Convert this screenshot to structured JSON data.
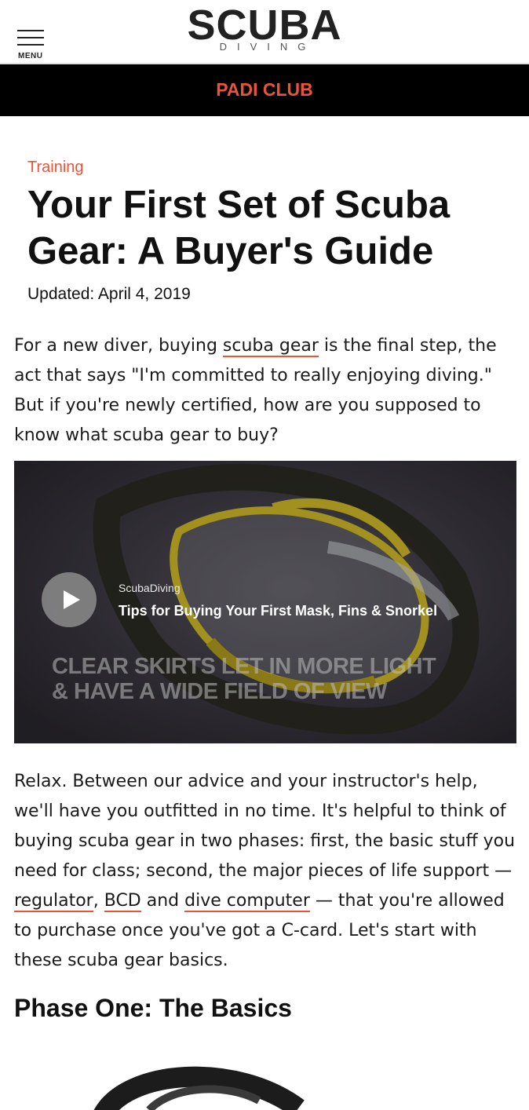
{
  "header": {
    "menu_label": "MENU",
    "logo_main": "SCUBA",
    "logo_sub": "DIVING"
  },
  "promo_bar": {
    "label": "PADI CLUB",
    "color": "#e8553a"
  },
  "article": {
    "category": "Training",
    "title": "Your First Set of Scuba Gear: A Buyer's Guide",
    "updated": "Updated: April 4, 2019",
    "para1": {
      "before_link": "For a new diver, buying ",
      "link": "scuba gear",
      "after_link": " is the final step, the act that says \"I'm committed to really enjoying diving.\" But if you're newly certified, how are you supposed to know what scuba gear to buy?"
    },
    "video": {
      "channel": "ScubaDiving",
      "title": "Tips for Buying Your First Mask, Fins & Snorkel",
      "caption_line1": "CLEAR SKIRTS LET IN MORE LIGHT",
      "caption_line2": "& HAVE A WIDE FIELD OF VIEW"
    },
    "para2": {
      "text1": "Relax. Between our advice and your instructor's help, we'll have you outfitted in no time. It's helpful to think of buying scuba gear in two phases: first, the basic stuff you need for class; second, the major pieces of life support — ",
      "link1": "regulator",
      "text2": ", ",
      "link2": "BCD",
      "text3": " and ",
      "link3": "dive computer",
      "text4": " — that you're allowed to purchase once you've got a C-card. Let's start with these scuba gear basics."
    },
    "section_heading": "Phase One: The Basics"
  },
  "icons": {
    "menu": "hamburger-icon",
    "play": "play-icon"
  }
}
